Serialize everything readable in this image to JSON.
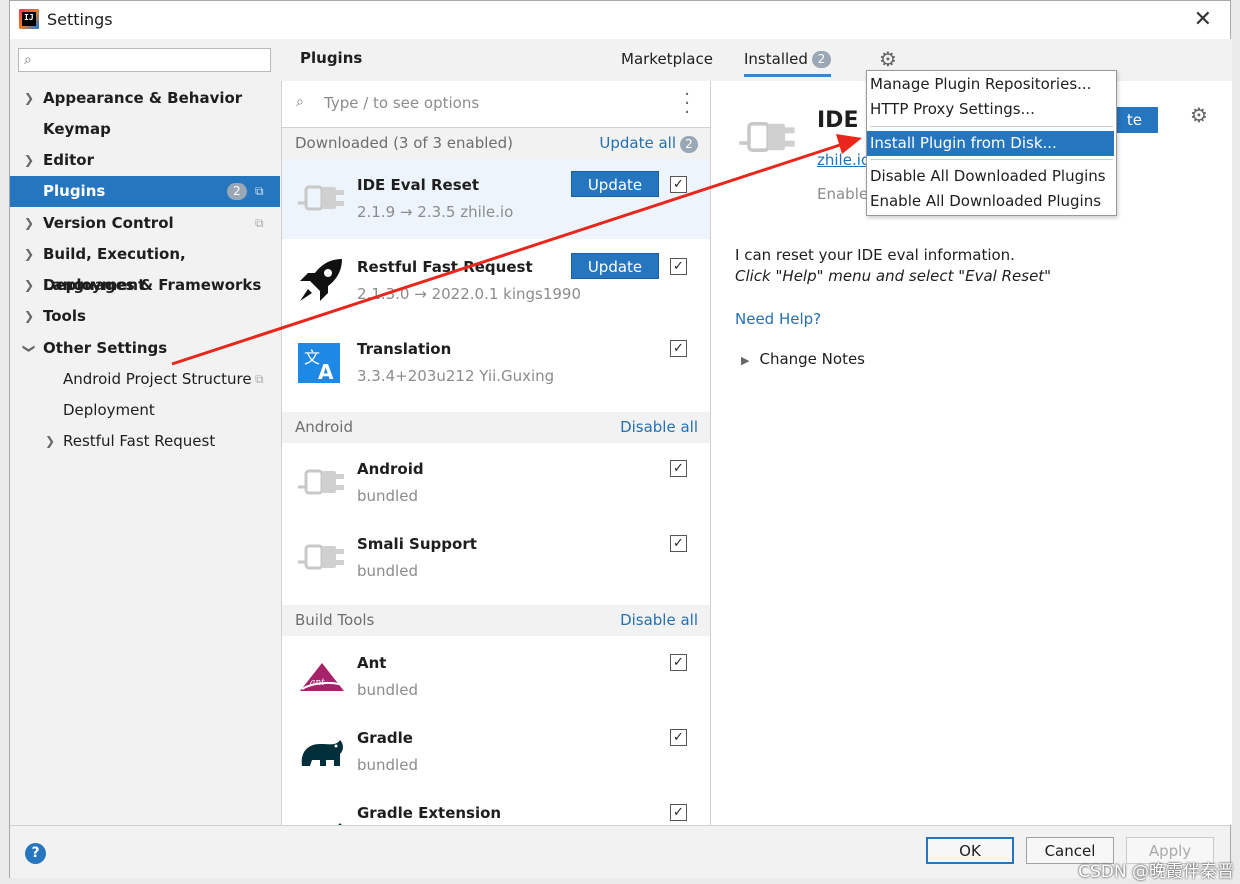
{
  "window": {
    "title": "Settings"
  },
  "sidebar": {
    "search_placeholder": "",
    "items": [
      {
        "label": "Appearance & Behavior",
        "expandable": true
      },
      {
        "label": "Keymap",
        "expandable": false
      },
      {
        "label": "Editor",
        "expandable": true
      },
      {
        "label": "Plugins",
        "badge": "2",
        "selected": true
      },
      {
        "label": "Version Control",
        "expandable": true
      },
      {
        "label": "Build, Execution, Deployment",
        "expandable": true
      },
      {
        "label": "Languages & Frameworks",
        "expandable": true
      },
      {
        "label": "Tools",
        "expandable": true
      },
      {
        "label": "Other Settings",
        "expanded": true
      },
      {
        "label": "Android Project Structure"
      },
      {
        "label": "Deployment"
      },
      {
        "label": "Restful Fast Request",
        "expandable": true
      }
    ]
  },
  "header": {
    "title": "Plugins",
    "tab_marketplace": "Marketplace",
    "tab_installed": "Installed",
    "installed_badge": "2"
  },
  "list": {
    "search_placeholder": "Type / to see options",
    "sections": {
      "downloaded": {
        "name": "Downloaded (3 of 3 enabled)",
        "action": "Update all",
        "badge": "2"
      },
      "android": {
        "name": "Android",
        "action": "Disable all"
      },
      "build_tools": {
        "name": "Build Tools",
        "action": "Disable all"
      }
    },
    "plugins": [
      {
        "name": "IDE Eval Reset",
        "version": "2.1.9 → 2.3.5  zhile.io",
        "update_label": "Update",
        "checked": true
      },
      {
        "name": "Restful Fast Request",
        "version": "2.1.3.0 → 2022.0.1  kings1990",
        "update_label": "Update",
        "checked": true
      },
      {
        "name": "Translation",
        "version": "3.3.4+203u212  Yii.Guxing",
        "checked": true
      },
      {
        "name": "Android",
        "version": "bundled",
        "checked": true
      },
      {
        "name": "Smali Support",
        "version": "bundled",
        "checked": true
      },
      {
        "name": "Ant",
        "version": "bundled",
        "checked": true
      },
      {
        "name": "Gradle",
        "version": "bundled",
        "checked": true
      },
      {
        "name": "Gradle Extension",
        "version": "",
        "checked": true
      }
    ]
  },
  "detail": {
    "name": "IDE E",
    "vendor": "zhile.io",
    "status": "Enable",
    "update_label": "te",
    "desc_line1": "I can reset your IDE eval information.",
    "desc_line2": "Click \"Help\" menu and select \"Eval Reset\"",
    "help_link": "Need Help?",
    "change_notes": "Change Notes"
  },
  "gear_menu": {
    "items": [
      "Manage Plugin Repositories...",
      "HTTP Proxy Settings...",
      "Install Plugin from Disk...",
      "Disable All Downloaded Plugins",
      "Enable All Downloaded Plugins"
    ],
    "selected": 2
  },
  "footer": {
    "help": "?",
    "ok": "OK",
    "cancel": "Cancel",
    "apply": "Apply"
  },
  "watermark": "CSDN @晚霞伴秦晋",
  "colors": {
    "accent": "#2675bf",
    "link": "#2470b3",
    "annotation_arrow": "#e8261b"
  }
}
